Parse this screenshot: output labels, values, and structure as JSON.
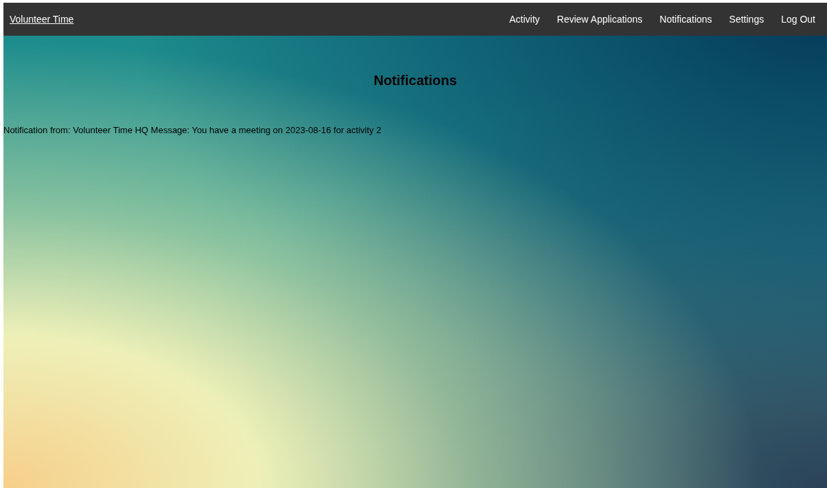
{
  "navbar": {
    "brand": "Volunteer Time",
    "links": [
      {
        "label": "Activity"
      },
      {
        "label": "Review Applications"
      },
      {
        "label": "Notifications"
      },
      {
        "label": "Settings"
      },
      {
        "label": "Log Out"
      }
    ]
  },
  "heading": "Notifications",
  "notifications": [
    {
      "text": "Notification from: Volunteer Time HQ Message: You have a meeting on 2023-08-16 for activity 2"
    }
  ]
}
